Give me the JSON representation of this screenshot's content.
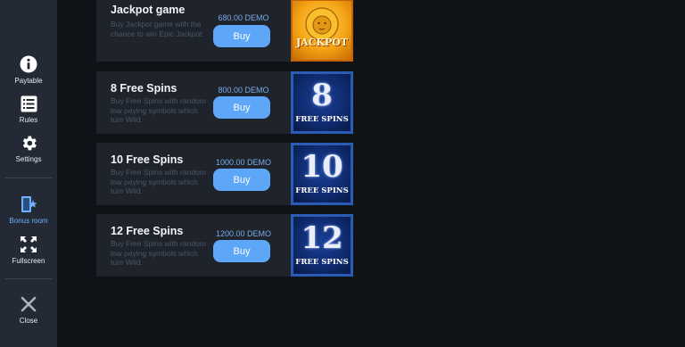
{
  "sidebar": {
    "items": [
      {
        "label": "Paytable",
        "icon": "info-icon"
      },
      {
        "label": "Rules",
        "icon": "list-icon"
      },
      {
        "label": "Settings",
        "icon": "gear-icon"
      },
      {
        "label": "Bonus room",
        "icon": "bonus-door-icon",
        "active": true
      },
      {
        "label": "Fullscreen",
        "icon": "fullscreen-icon"
      },
      {
        "label": "Close",
        "icon": "close-icon"
      }
    ]
  },
  "offers": [
    {
      "title": "Jackpot game",
      "desc": "Buy Jackpot game with the chance to win Epic Jackpot.",
      "price": "680.00 DEMO",
      "buy_label": "Buy",
      "thumb_text": "JACKPOT"
    },
    {
      "title": "8 Free Spins",
      "desc": "Buy Free Spins with random low paying symbols which turn Wild.",
      "price": "800.00 DEMO",
      "buy_label": "Buy",
      "thumb_number": "8",
      "thumb_text": "FREE SPINS"
    },
    {
      "title": "10 Free Spins",
      "desc": "Buy Free Spins with random low paying symbols which turn Wild.",
      "price": "1000.00 DEMO",
      "buy_label": "Buy",
      "thumb_number": "10",
      "thumb_text": "FREE SPINS"
    },
    {
      "title": "12 Free Spins",
      "desc": "Buy Free Spins with random low paying symbols which turn Wild.",
      "price": "1200.00 DEMO",
      "buy_label": "Buy",
      "thumb_number": "12",
      "thumb_text": "FREE SPINS"
    }
  ],
  "colors": {
    "accent": "#5ea6f7",
    "sidebar_bg": "#232a35",
    "card_bg": "#1f242c",
    "page_bg": "#0f1318"
  }
}
